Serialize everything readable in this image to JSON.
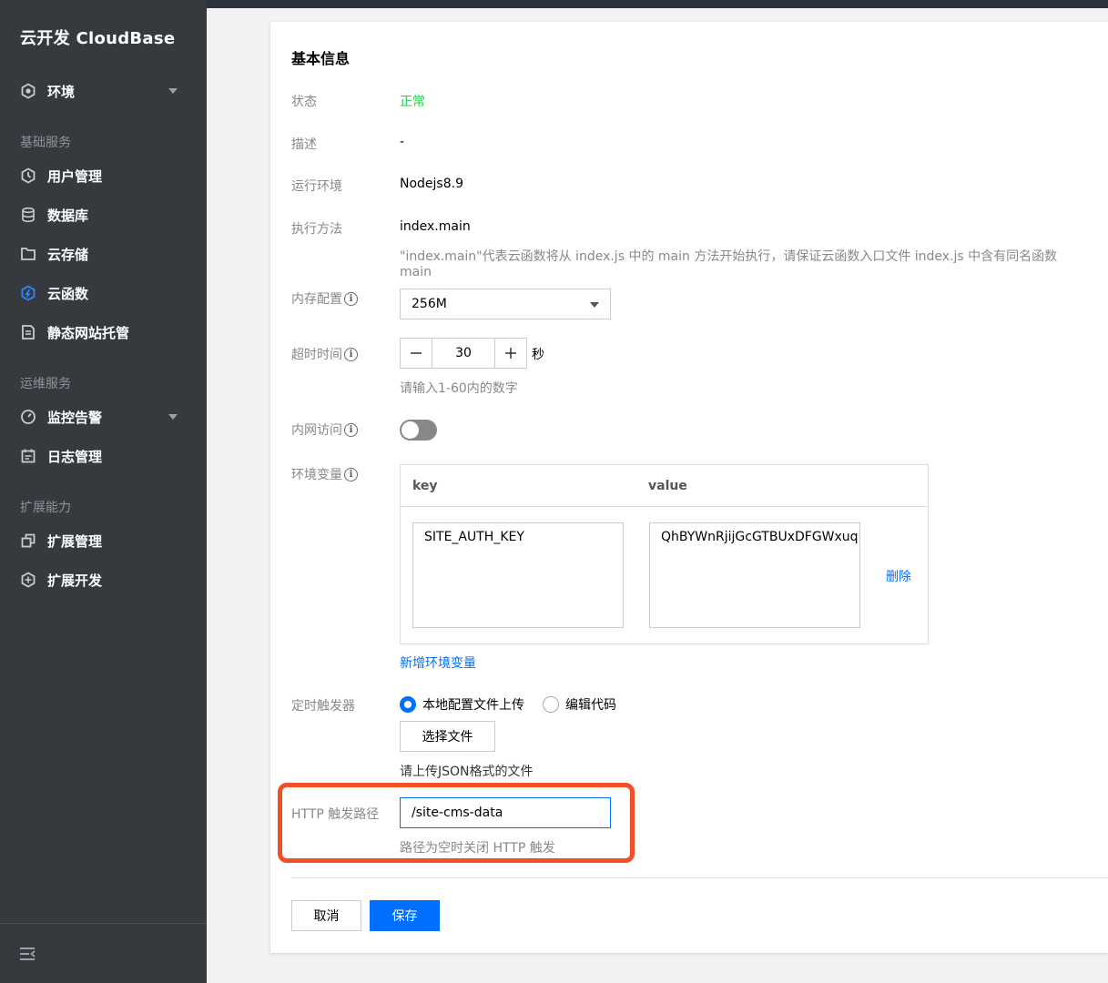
{
  "sidebar": {
    "brand": "云开发 CloudBase",
    "env": {
      "label": "环境"
    },
    "groups": [
      "基础服务",
      "运维服务",
      "扩展能力"
    ],
    "items": [
      {
        "label": "用户管理",
        "icon": "user-icon"
      },
      {
        "label": "数据库",
        "icon": "database-icon"
      },
      {
        "label": "云存储",
        "icon": "folder-icon"
      },
      {
        "label": "云函数",
        "icon": "function-icon",
        "active": true
      },
      {
        "label": "静态网站托管",
        "icon": "document-icon"
      },
      {
        "label": "监控告警",
        "icon": "gauge-icon"
      },
      {
        "label": "日志管理",
        "icon": "log-icon"
      },
      {
        "label": "扩展管理",
        "icon": "extension-icon"
      },
      {
        "label": "扩展开发",
        "icon": "extension-dev-icon"
      }
    ],
    "accent_color": "#006eff"
  },
  "main": {
    "section_title": "基本信息",
    "status_label": "状态",
    "status_value": "正常",
    "desc_label": "描述",
    "desc_value": "-",
    "runtime_label": "运行环境",
    "runtime_value": "Nodejs8.9",
    "handler_label": "执行方法",
    "handler_value": "index.main",
    "handler_hint": "\"index.main\"代表云函数将从 index.js 中的 main 方法开始执行，请保证云函数入口文件 index.js 中含有同名函数 main",
    "memory_label": "内存配置",
    "memory_value": "256M",
    "timeout_label": "超时时间",
    "timeout_value": "30",
    "timeout_unit": "秒",
    "timeout_hint": "请输入1-60内的数字",
    "vpc_label": "内网访问",
    "vpc_enabled": false,
    "env_label": "环境变量",
    "env_table": {
      "key_header": "key",
      "value_header": "value",
      "rows": [
        {
          "key": "SITE_AUTH_KEY",
          "value": "QhBYWnRjijGcGTBUxDFGWxuq",
          "delete": "删除"
        }
      ]
    },
    "add_env": "新增环境变量",
    "trigger_label": "定时触发器",
    "trigger_options": [
      "本地配置文件上传",
      "编辑代码"
    ],
    "trigger_selected": "本地配置文件上传",
    "choose_file": "选择文件",
    "upload_hint": "请上传JSON格式的文件",
    "http_label": "HTTP 触发路径",
    "http_value": "/site-cms-data",
    "http_hint": "路径为空时关闭 HTTP 触发",
    "cancel": "取消",
    "save": "保存",
    "status_color": "#29cc4a",
    "highlight_color": "#f04f27"
  }
}
